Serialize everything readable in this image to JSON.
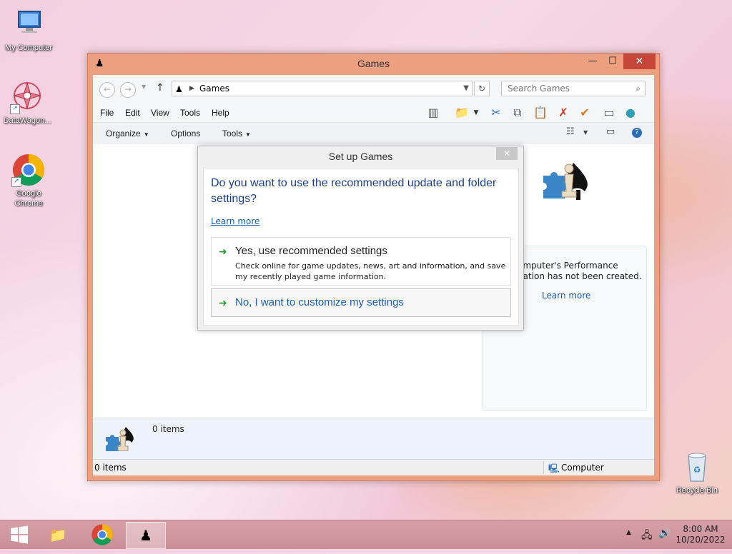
{
  "desktop": {
    "icons": [
      {
        "label": "My Computer"
      },
      {
        "label": "DataWagon..."
      },
      {
        "label": "Google\nChrome"
      },
      {
        "label": "Recycle Bin"
      }
    ]
  },
  "window": {
    "title": "Games",
    "address": {
      "crumb": "Games"
    },
    "search": {
      "placeholder": "Search Games"
    },
    "menu": {
      "file": "File",
      "edit": "Edit",
      "view": "View",
      "tools": "Tools",
      "help": "Help"
    },
    "commands": {
      "organize": "Organize",
      "options": "Options",
      "tools": "Tools"
    },
    "right_pane": {
      "text_line1": "omputer's Performance",
      "text_line2": "nation has not been created.",
      "link": "Learn more"
    },
    "details": {
      "count": "0 items"
    },
    "status": {
      "left": "0 items",
      "right": "Computer"
    }
  },
  "dialog": {
    "title": "Set up Games",
    "question": "Do you want to use the recommended update and folder settings?",
    "learn_more": "Learn more",
    "option1": {
      "title": "Yes, use recommended settings",
      "description": "Check online for game updates, news, art and information, and save my recently played game information."
    },
    "option2": {
      "title": "No, I want to customize my settings"
    }
  },
  "taskbar": {
    "clock_time": "8:00 AM",
    "clock_date": "10/20/2022"
  },
  "colors": {
    "accent_link": "#1a5fb4",
    "close_red": "#c7463a",
    "window_frame": "#eda07f"
  }
}
